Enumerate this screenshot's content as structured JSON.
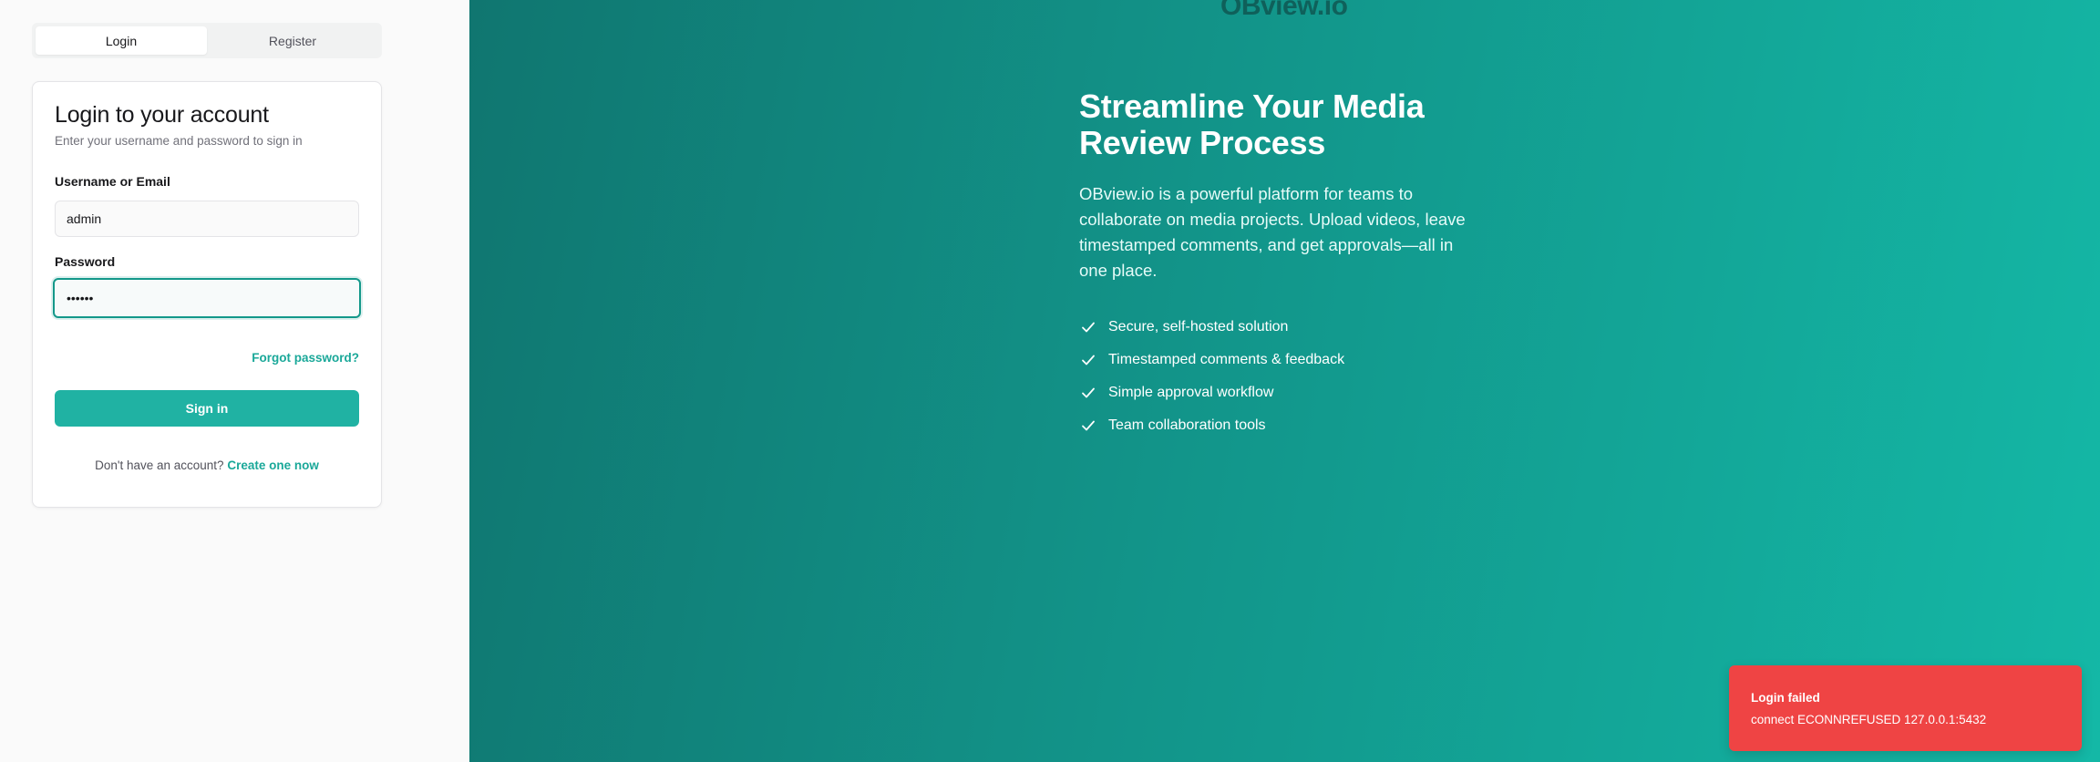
{
  "tabs": [
    {
      "label": "Login",
      "active": true
    },
    {
      "label": "Register",
      "active": false
    }
  ],
  "login_card": {
    "title": "Login to your account",
    "subtitle": "Enter your username and password to sign in",
    "username_label": "Username or Email",
    "username_value": "admin",
    "password_label": "Password",
    "password_value": "••••••",
    "forgot_label": "Forgot password?",
    "signin_label": "Sign in",
    "no_account_text": "Don't have an account?",
    "create_label": "Create one now"
  },
  "hero": {
    "logo": "OBview.io",
    "title_line1": "Streamline Your Media",
    "title_line2": "Review Process",
    "description": "OBview.io is a powerful platform for teams to collaborate on media projects. Upload videos, leave timestamped comments, and get approvals—all in one place.",
    "features": [
      "Secure, self-hosted solution",
      "Timestamped comments & feedback",
      "Simple approval workflow",
      "Team collaboration tools"
    ]
  },
  "toast": {
    "title": "Login failed",
    "message": "connect ECONNREFUSED 127.0.0.1:5432"
  },
  "colors": {
    "accent": "#20b2a3",
    "accent_text": "#1aa899",
    "toast_bg": "#ef4444",
    "hero_gradient_start": "#107670",
    "hero_gradient_end": "#14b8a6"
  }
}
